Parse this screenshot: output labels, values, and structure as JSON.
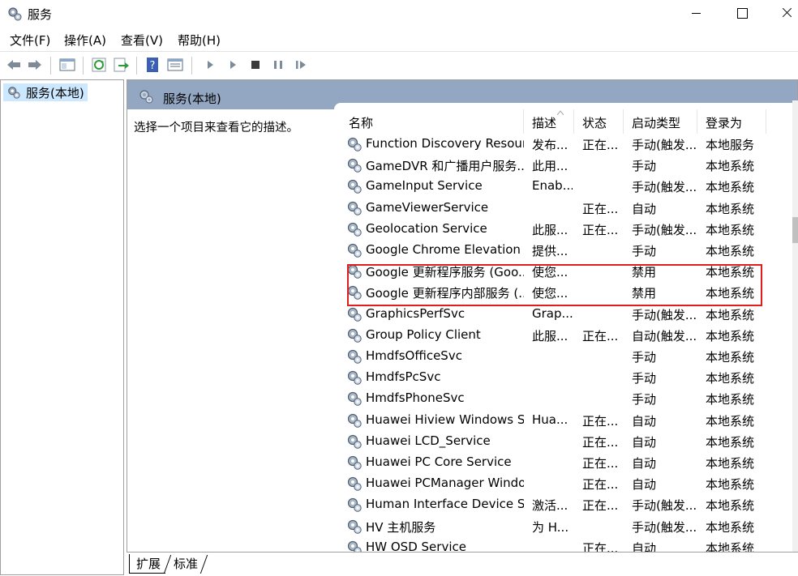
{
  "window": {
    "title": "服务"
  },
  "menu": [
    "文件(F)",
    "操作(A)",
    "查看(V)",
    "帮助(H)"
  ],
  "toolbar": {
    "buttons": [
      "back-icon",
      "forward-icon",
      "console-tree-icon",
      "refresh-icon",
      "export-list-icon",
      "help-icon",
      "properties-icon",
      "start-service-icon",
      "start-service-alt-icon",
      "stop-service-icon",
      "pause-service-icon",
      "resume-service-icon"
    ]
  },
  "tree": {
    "root": "服务(本地)"
  },
  "pane": {
    "title": "服务(本地)",
    "description_hint": "选择一个项目来查看它的描述。"
  },
  "columns": [
    "名称",
    "描述",
    "状态",
    "启动类型",
    "登录为"
  ],
  "rows": [
    {
      "name": "Function Discovery Resour...",
      "desc": "发布...",
      "status": "正在...",
      "startup": "手动(触发...",
      "logon": "本地服务"
    },
    {
      "name": "GameDVR 和广播用户服务...",
      "desc": "此用...",
      "status": "",
      "startup": "手动",
      "logon": "本地系统"
    },
    {
      "name": "GameInput Service",
      "desc": "Enab...",
      "status": "",
      "startup": "手动(触发...",
      "logon": "本地系统"
    },
    {
      "name": "GameViewerService",
      "desc": "",
      "status": "正在...",
      "startup": "自动",
      "logon": "本地系统"
    },
    {
      "name": "Geolocation Service",
      "desc": "此服...",
      "status": "正在...",
      "startup": "手动(触发...",
      "logon": "本地系统"
    },
    {
      "name": "Google Chrome Elevation ...",
      "desc": "提供...",
      "status": "",
      "startup": "手动",
      "logon": "本地系统"
    },
    {
      "name": "Google 更新程序服务 (Goo...",
      "desc": "使您...",
      "status": "",
      "startup": "禁用",
      "logon": "本地系统"
    },
    {
      "name": "Google 更新程序内部服务 (...",
      "desc": "使您...",
      "status": "",
      "startup": "禁用",
      "logon": "本地系统"
    },
    {
      "name": "GraphicsPerfSvc",
      "desc": "Grap...",
      "status": "",
      "startup": "手动(触发...",
      "logon": "本地系统"
    },
    {
      "name": "Group Policy Client",
      "desc": "此服...",
      "status": "正在...",
      "startup": "自动(触发...",
      "logon": "本地系统"
    },
    {
      "name": "HmdfsOfficeSvc",
      "desc": "",
      "status": "",
      "startup": "手动",
      "logon": "本地系统"
    },
    {
      "name": "HmdfsPcSvc",
      "desc": "",
      "status": "",
      "startup": "手动",
      "logon": "本地系统"
    },
    {
      "name": "HmdfsPhoneSvc",
      "desc": "",
      "status": "",
      "startup": "手动",
      "logon": "本地系统"
    },
    {
      "name": "Huawei Hiview Windows S...",
      "desc": "Hua...",
      "status": "正在...",
      "startup": "自动",
      "logon": "本地系统"
    },
    {
      "name": "Huawei LCD_Service",
      "desc": "",
      "status": "正在...",
      "startup": "自动",
      "logon": "本地系统"
    },
    {
      "name": "Huawei PC Core Service",
      "desc": "",
      "status": "正在...",
      "startup": "自动",
      "logon": "本地系统"
    },
    {
      "name": "Huawei PCManager Windo...",
      "desc": "",
      "status": "正在...",
      "startup": "自动",
      "logon": "本地系统"
    },
    {
      "name": "Human Interface Device S...",
      "desc": "激活...",
      "status": "正在...",
      "startup": "手动(触发...",
      "logon": "本地系统"
    },
    {
      "name": "HV 主机服务",
      "desc": "为 H...",
      "status": "",
      "startup": "手动(触发...",
      "logon": "本地系统"
    },
    {
      "name": "HW OSD Service",
      "desc": "",
      "status": "正在...",
      "startup": "自动",
      "logon": "本地系统"
    }
  ],
  "tabs": [
    "扩展",
    "标准"
  ],
  "colors": {
    "header_band": "#93a7c3",
    "selection": "#cce8ff",
    "highlight_box": "#e11d1d"
  }
}
